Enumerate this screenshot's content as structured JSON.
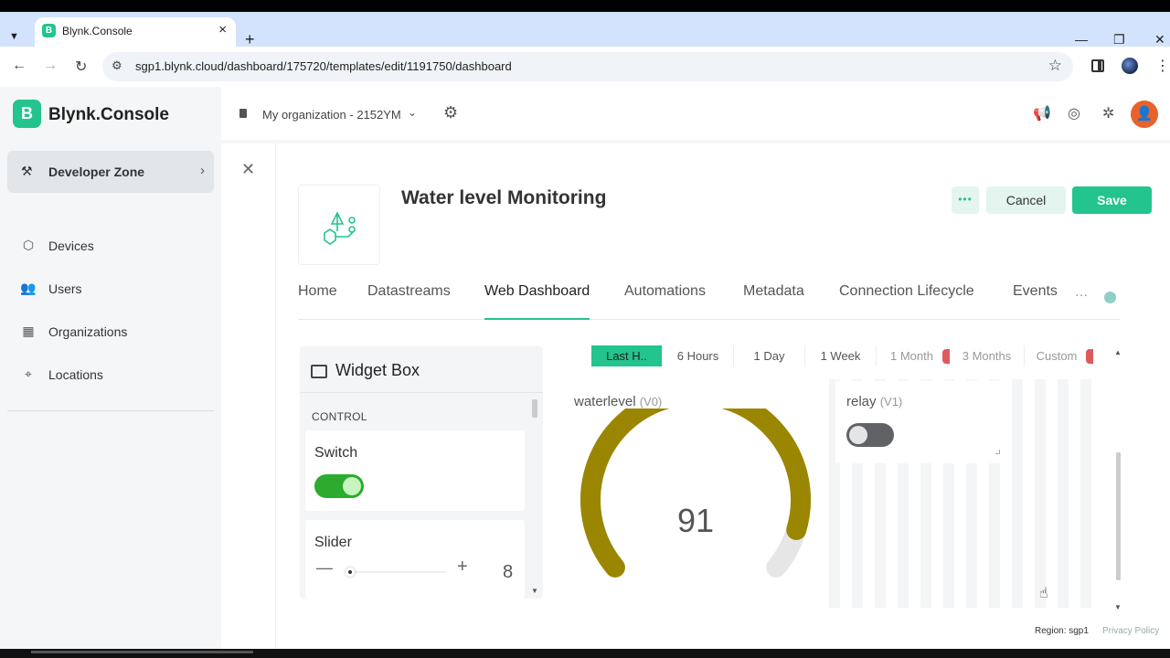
{
  "browser": {
    "tab_title": "Blynk.Console",
    "favicon_letter": "B",
    "url": "sgp1.blynk.cloud/dashboard/175720/templates/edit/1191750/dashboard",
    "window_controls": [
      "—",
      "❐",
      "✕"
    ]
  },
  "app": {
    "logo_letter": "B",
    "logo_text": "Blynk.Console",
    "org_name": "My organization - 2152YM",
    "avatar_initial": "👤"
  },
  "sidebar": {
    "developer_zone": "Developer Zone",
    "items": [
      {
        "label": "Devices",
        "icon": "cube-icon"
      },
      {
        "label": "Users",
        "icon": "users-icon"
      },
      {
        "label": "Organizations",
        "icon": "building-icon"
      },
      {
        "label": "Locations",
        "icon": "location-pin-icon"
      }
    ]
  },
  "template": {
    "title": "Water level Monitoring",
    "more_label": "•••",
    "cancel_label": "Cancel",
    "save_label": "Save"
  },
  "tabs": [
    {
      "label": "Home",
      "active": false
    },
    {
      "label": "Datastreams",
      "active": false
    },
    {
      "label": "Web Dashboard",
      "active": true
    },
    {
      "label": "Automations",
      "active": false
    },
    {
      "label": "Metadata",
      "active": false
    },
    {
      "label": "Connection Lifecycle",
      "active": false
    },
    {
      "label": "Events",
      "active": false
    }
  ],
  "tabs_more": "···",
  "widget_box": {
    "title": "Widget Box",
    "section": "CONTROL",
    "switch_label": "Switch",
    "slider_label": "Slider",
    "slider_minus": "—",
    "slider_plus": "+",
    "slider_value": "8"
  },
  "time_range": [
    "Last H..",
    "6 Hours",
    "1 Day",
    "1 Week",
    "1 Month",
    "3 Months",
    "Custom"
  ],
  "widgets": {
    "gauge": {
      "name": "waterlevel",
      "pin": "(V0)",
      "value": "91",
      "fraction": 0.91,
      "color": "#9a8600"
    },
    "relay": {
      "name": "relay",
      "pin": "(V1)",
      "state": "off"
    }
  },
  "footer": {
    "region": "Region: sgp1",
    "privacy": "Privacy Policy"
  },
  "colors": {
    "accent": "#23c48e",
    "switch_on": "#2cab2e",
    "gauge": "#9a8600"
  }
}
